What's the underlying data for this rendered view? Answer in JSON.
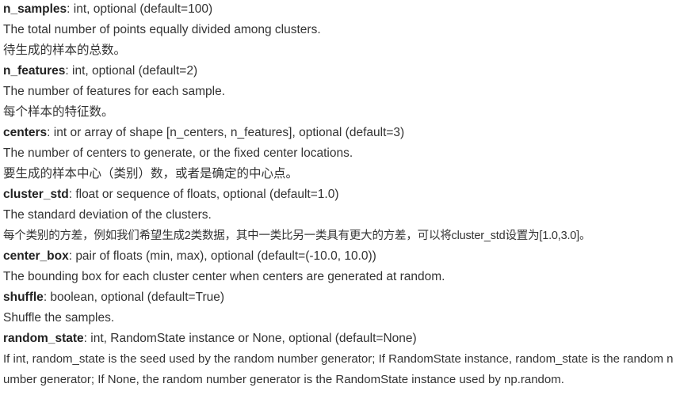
{
  "params": [
    {
      "name": "n_samples",
      "type": ": int, optional (default=100)",
      "desc": "The total number of points equally divided among clusters.",
      "zh": "待生成的样本的总数。"
    },
    {
      "name": "n_features",
      "type": ": int, optional (default=2)",
      "desc": "The number of features for each sample.",
      "zh": "每个样本的特征数。"
    },
    {
      "name": "centers",
      "type": ": int or array of shape [n_centers, n_features], optional (default=3)",
      "desc": "The number of centers to generate, or the fixed center locations.",
      "zh": "要生成的样本中心（类别）数，或者是确定的中心点。"
    },
    {
      "name": "cluster_std",
      "type": ": float or sequence of floats, optional (default=1.0)",
      "desc": "The standard deviation of the clusters.",
      "zh": "每个类别的方差，例如我们希望生成2类数据，其中一类比另一类具有更大的方差，可以将cluster_std设置为[1.0,3.0]。"
    },
    {
      "name": "center_box",
      "type": ": pair of floats (min, max), optional (default=(-10.0, 10.0))",
      "desc": "The bounding box for each cluster center when centers are generated at random."
    },
    {
      "name": "shuffle",
      "type": ": boolean, optional (default=True)",
      "desc": "Shuffle the samples."
    },
    {
      "name": "random_state",
      "type": ": int, RandomState instance or None, optional (default=None)",
      "desc": "If int, random_state is the seed used by the random number generator; If RandomState instance, random_state is the random number generator; If None, the random number generator is the RandomState instance used by np.random."
    }
  ]
}
